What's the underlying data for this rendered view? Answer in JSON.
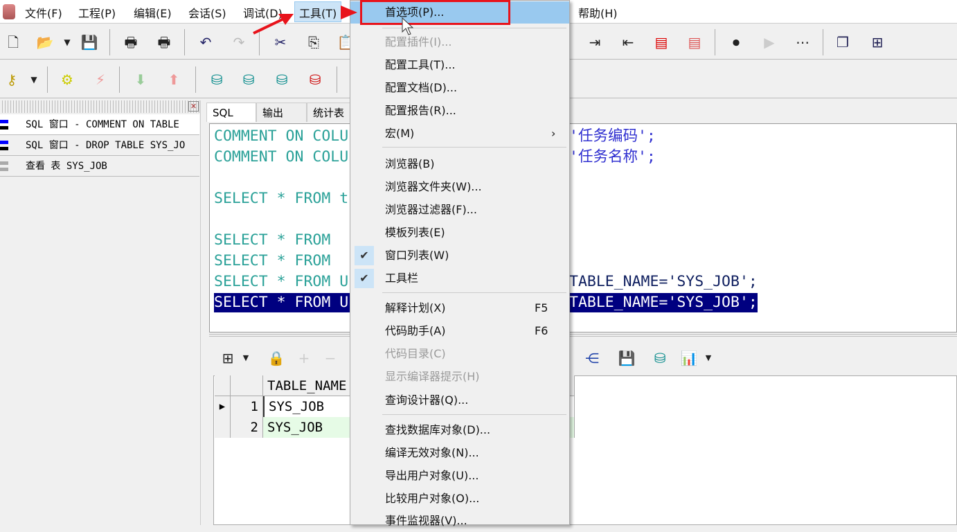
{
  "menubar": {
    "items": [
      "文件(F)",
      "工程(P)",
      "编辑(E)",
      "会话(S)",
      "调试(D)",
      "工具(T)",
      "帮助(H)"
    ]
  },
  "toolbar1": {
    "icons": [
      "new-file-icon",
      "open-folder-icon",
      "save-icon",
      "print-icon",
      "print-preview-icon",
      "undo-icon",
      "redo-icon",
      "cut-icon",
      "copy-icon",
      "paste-icon",
      "indent-icon",
      "unindent-icon",
      "comment-icon",
      "uncomment-icon",
      "record-macro-icon",
      "play-macro-icon",
      "macro-list-icon",
      "cascade-windows-icon",
      "tile-windows-icon"
    ]
  },
  "toolbar2": {
    "icons": [
      "key-icon",
      "execute-icon",
      "break-icon",
      "commit-icon",
      "rollback-icon",
      "db-info-icon",
      "sql-db-icon",
      "find-db-icon",
      "disconnect-db-icon"
    ]
  },
  "window_list": {
    "items": [
      "SQL 窗口 - COMMENT ON TABLE",
      "SQL 窗口 - DROP TABLE SYS_JO",
      "查看 表 SYS_JOB"
    ]
  },
  "tabs": [
    "SQL",
    "输出",
    "统计表"
  ],
  "editor": {
    "lines": [
      {
        "left": "COMMENT ON COLU",
        "right": "'任务编码';"
      },
      {
        "left": "COMMENT ON COLU",
        "right": "'任务名称';"
      },
      {
        "left": "",
        "right": ""
      },
      {
        "left": "SELECT * FROM t",
        "right": ""
      },
      {
        "left": "",
        "right": ""
      },
      {
        "left": "SELECT * FROM",
        "right": ""
      },
      {
        "left": "SELECT * FROM",
        "right": ""
      },
      {
        "left": "SELECT * FROM U",
        "right": "TABLE_NAME='SYS_JOB';"
      },
      {
        "left": "SELECT * FROM U",
        "right": "TABLE_NAME='SYS_JOB';",
        "selected": true
      }
    ]
  },
  "results": {
    "columns": [
      "TABLE_NAME"
    ],
    "rows": [
      {
        "n": "1",
        "v": "SYS_JOB",
        "current": true
      },
      {
        "n": "2",
        "v": "SYS_JOB"
      }
    ]
  },
  "tools_menu": {
    "items": [
      {
        "label": "首选项(P)...",
        "highlighted": true
      },
      {
        "label": "配置插件(I)...",
        "disabled": true
      },
      {
        "label": "配置工具(T)..."
      },
      {
        "label": "配置文档(D)..."
      },
      {
        "label": "配置报告(R)..."
      },
      {
        "label": "宏(M)",
        "submenu": "›"
      },
      {
        "label": "浏览器(B)"
      },
      {
        "label": "浏览器文件夹(W)..."
      },
      {
        "label": "浏览器过滤器(F)..."
      },
      {
        "label": "模板列表(E)"
      },
      {
        "label": "窗口列表(W)",
        "checked": true
      },
      {
        "label": "工具栏",
        "checked": true
      },
      {
        "label": "解释计划(X)",
        "shortcut": "F5"
      },
      {
        "label": "代码助手(A)",
        "shortcut": "F6"
      },
      {
        "label": "代码目录(C)",
        "disabled": true
      },
      {
        "label": "显示编译器提示(H)",
        "disabled": true
      },
      {
        "label": "查询设计器(Q)..."
      },
      {
        "label": "查找数据库对象(D)..."
      },
      {
        "label": "编译无效对象(N)..."
      },
      {
        "label": "导出用户对象(U)..."
      },
      {
        "label": "比较用户对象(O)..."
      },
      {
        "label": "事件监视器(V)..."
      }
    ]
  },
  "colors": {
    "highlight": "#99c9ef",
    "annotation": "#e8131b",
    "selection": "#000080"
  }
}
